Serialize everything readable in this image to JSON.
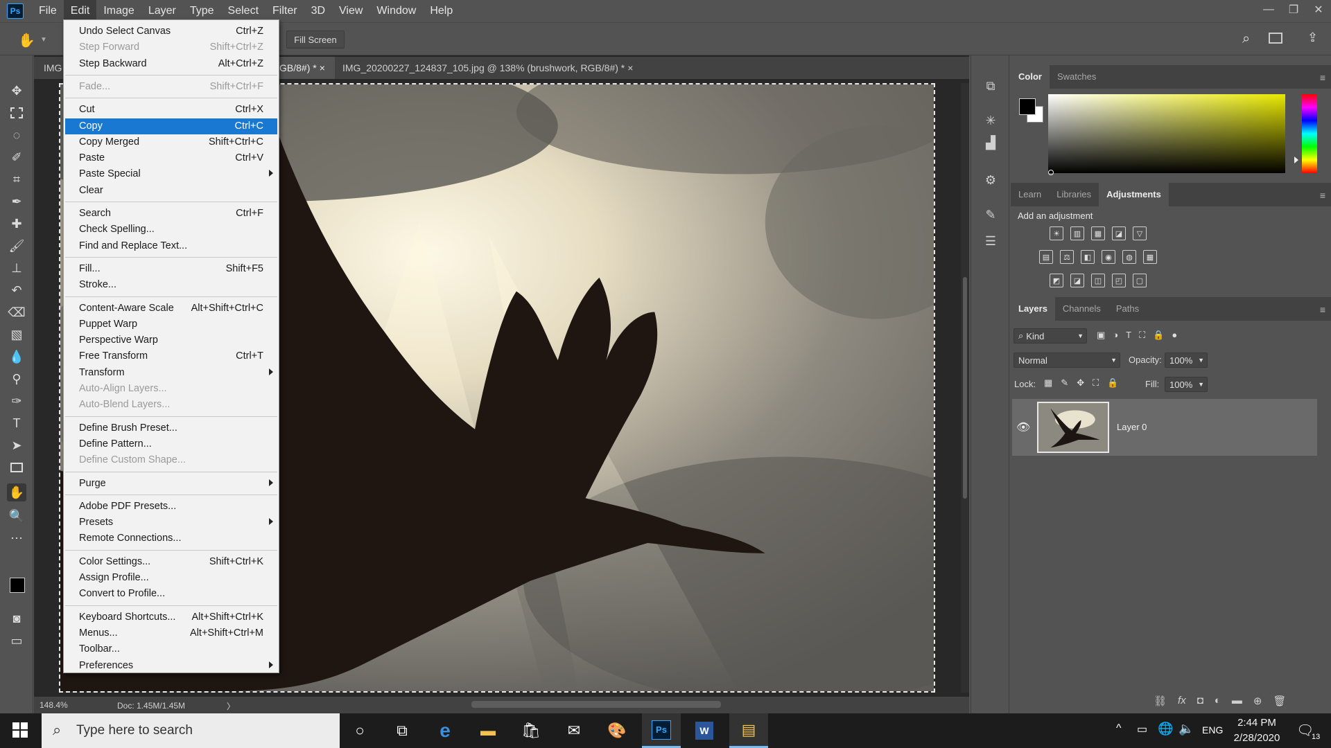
{
  "app": {
    "logo_text": "Ps",
    "menus": [
      "File",
      "Edit",
      "Image",
      "Layer",
      "Type",
      "Select",
      "Filter",
      "3D",
      "View",
      "Window",
      "Help"
    ],
    "window_controls": [
      "—",
      "❐",
      "✕"
    ]
  },
  "options_bar": {
    "fill_screen_label": "Fill Screen"
  },
  "tabs": {
    "tab1_label": "IMG",
    "tab2_label": "GB/8#) *",
    "tab3_label": "IMG_20200227_124837_105.jpg @ 138% (brushwork, RGB/8#) *",
    "close_glyph": "×"
  },
  "status": {
    "zoom": "148.4%",
    "doc": "Doc: 1.45M/1.45M",
    "arrow": "〉"
  },
  "edit_menu": {
    "items": [
      {
        "label": "Undo Select Canvas",
        "shortcut": "Ctrl+Z"
      },
      {
        "label": "Step Forward",
        "shortcut": "Shift+Ctrl+Z",
        "disabled": true
      },
      {
        "label": "Step Backward",
        "shortcut": "Alt+Ctrl+Z"
      },
      {
        "label": "Fade...",
        "shortcut": "Shift+Ctrl+F",
        "disabled": true
      },
      {
        "label": "Cut",
        "shortcut": "Ctrl+X"
      },
      {
        "label": "Copy",
        "shortcut": "Ctrl+C",
        "highlighted": true
      },
      {
        "label": "Copy Merged",
        "shortcut": "Shift+Ctrl+C"
      },
      {
        "label": "Paste",
        "shortcut": "Ctrl+V"
      },
      {
        "label": "Paste Special",
        "shortcut": "",
        "submenu": true
      },
      {
        "label": "Clear",
        "shortcut": ""
      },
      {
        "label": "Search",
        "shortcut": "Ctrl+F"
      },
      {
        "label": "Check Spelling...",
        "shortcut": ""
      },
      {
        "label": "Find and Replace Text...",
        "shortcut": ""
      },
      {
        "label": "Fill...",
        "shortcut": "Shift+F5"
      },
      {
        "label": "Stroke...",
        "shortcut": ""
      },
      {
        "label": "Content-Aware Scale",
        "shortcut": "Alt+Shift+Ctrl+C"
      },
      {
        "label": "Puppet Warp",
        "shortcut": ""
      },
      {
        "label": "Perspective Warp",
        "shortcut": ""
      },
      {
        "label": "Free Transform",
        "shortcut": "Ctrl+T"
      },
      {
        "label": "Transform",
        "shortcut": "",
        "submenu": true
      },
      {
        "label": "Auto-Align Layers...",
        "shortcut": "",
        "disabled": true
      },
      {
        "label": "Auto-Blend Layers...",
        "shortcut": "",
        "disabled": true
      },
      {
        "label": "Define Brush Preset...",
        "shortcut": ""
      },
      {
        "label": "Define Pattern...",
        "shortcut": ""
      },
      {
        "label": "Define Custom Shape...",
        "shortcut": "",
        "disabled": true
      },
      {
        "label": "Purge",
        "shortcut": "",
        "submenu": true
      },
      {
        "label": "Adobe PDF Presets...",
        "shortcut": ""
      },
      {
        "label": "Presets",
        "shortcut": "",
        "submenu": true
      },
      {
        "label": "Remote Connections...",
        "shortcut": ""
      },
      {
        "label": "Color Settings...",
        "shortcut": "Shift+Ctrl+K"
      },
      {
        "label": "Assign Profile...",
        "shortcut": ""
      },
      {
        "label": "Convert to Profile...",
        "shortcut": ""
      },
      {
        "label": "Keyboard Shortcuts...",
        "shortcut": "Alt+Shift+Ctrl+K"
      },
      {
        "label": "Menus...",
        "shortcut": "Alt+Shift+Ctrl+M"
      },
      {
        "label": "Toolbar...",
        "shortcut": ""
      },
      {
        "label": "Preferences",
        "shortcut": "",
        "submenu": true
      }
    ]
  },
  "color_panel": {
    "tabs": [
      "Color",
      "Swatches"
    ],
    "foreground": "#000000",
    "background": "#ffffff"
  },
  "adjustments_panel": {
    "tabs": [
      "Learn",
      "Libraries",
      "Adjustments"
    ],
    "heading": "Add an adjustment",
    "icons_row1": [
      "☀",
      "▥",
      "▦",
      "◪",
      "▽"
    ],
    "icons_row2": [
      "▤",
      "⚖",
      "◧",
      "◉",
      "◍",
      "▦"
    ],
    "icons_row3": [
      "◩",
      "◪",
      "◫",
      "◰",
      "▢"
    ]
  },
  "layers_panel": {
    "tabs": [
      "Layers",
      "Channels",
      "Paths"
    ],
    "filter_label": "Kind",
    "filter_icons": [
      "▣",
      "◑",
      "T",
      "⛶",
      "🔒",
      "●"
    ],
    "blend_mode": "Normal",
    "opacity_label": "Opacity:",
    "opacity_value": "100%",
    "lock_label": "Lock:",
    "lock_icons": [
      "▦",
      "✎",
      "✥",
      "⛶",
      "🔒"
    ],
    "fill_label": "Fill:",
    "fill_value": "100%",
    "layer_name": "Layer 0",
    "footer_icons": [
      "⛓",
      "fx",
      "◘",
      "◐",
      "▬",
      "⊕",
      "🗑"
    ]
  },
  "taskbar": {
    "search_placeholder": "Type here to search",
    "time": "2:44 PM",
    "date": "2/28/2020",
    "language": "ENG",
    "notification_count": "13"
  }
}
